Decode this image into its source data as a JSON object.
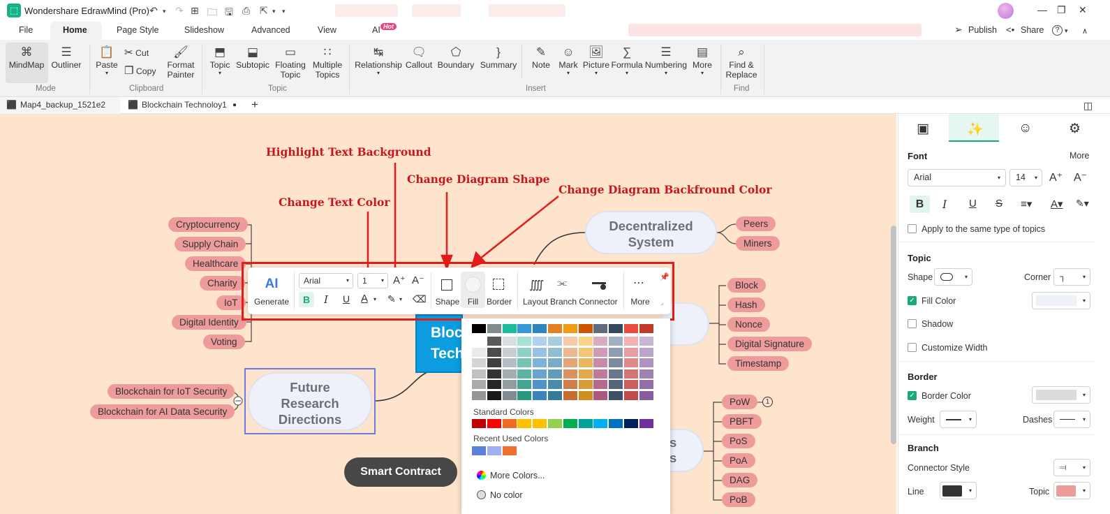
{
  "app": {
    "title": "Wondershare EdrawMind (Pro)",
    "logo_icon": "edrawmind-logo"
  },
  "menu": {
    "items": [
      "File",
      "Home",
      "Page Style",
      "Slideshow",
      "Advanced",
      "View",
      "AI"
    ],
    "active": "Home",
    "ai_badge": "Hot",
    "publish": "Publish",
    "share": "Share",
    "help": "?"
  },
  "ribbon": {
    "mode": {
      "label": "Mode",
      "mindmap": "MindMap",
      "outliner": "Outliner"
    },
    "clipboard": {
      "label": "Clipboard",
      "paste": "Paste",
      "cut": "Cut",
      "copy": "Copy",
      "format_painter": [
        "Format",
        "Painter"
      ]
    },
    "topic": {
      "label": "Topic",
      "topic": "Topic",
      "subtopic": "Subtopic",
      "floating": [
        "Floating",
        "Topic"
      ],
      "multiple": [
        "Multiple",
        "Topics"
      ]
    },
    "insert": {
      "label": "Insert",
      "relationship": "Relationship",
      "callout": "Callout",
      "boundary": "Boundary",
      "summary": "Summary",
      "note": "Note",
      "mark": "Mark",
      "picture": "Picture",
      "formula": "Formula",
      "numbering": "Numbering",
      "more": "More"
    },
    "find": {
      "label": "Find",
      "find_replace": [
        "Find &",
        "Replace"
      ]
    }
  },
  "tabs": [
    {
      "label": "Map4_backup_1521e2"
    },
    {
      "label": "Blockchain Technoloy1",
      "modified": true
    }
  ],
  "annotations": {
    "highlight": "Highlight Text Background",
    "shape": "Change Diagram Shape",
    "backcolor": "Change Diagram Backfround Color",
    "textcolor": "Change Text Color"
  },
  "mindmap": {
    "left_branches": [
      "Cryptocurrency",
      "Supply Chain",
      "Healthcare",
      "Charity",
      "IoT",
      "Digital Identity",
      "Voting"
    ],
    "future_topic": [
      "Future",
      "Research",
      "Directions"
    ],
    "future_subs": [
      "Blockchain for IoT Security",
      "Blockchain for AI Data Security"
    ],
    "decentralized": [
      "Decentralized",
      "System"
    ],
    "decentralized_subs": [
      "Peers",
      "Miners"
    ],
    "block_subs": [
      "Block",
      "Hash",
      "Nonce",
      "Digital Signature",
      "Timestamp"
    ],
    "consensus_subs": [
      "PoW",
      "PBFT",
      "PoS",
      "PoA",
      "DAG",
      "PoB"
    ],
    "consensus_partial": [
      "s",
      "s"
    ],
    "pow_badge": "1",
    "central_partial": [
      "Block",
      "Tech"
    ],
    "smart_contract": "Smart Contract"
  },
  "floating_toolbar": {
    "generate": "Generate",
    "ai_icon_text": "AI",
    "font": "Arial",
    "size": "1",
    "bold": "B",
    "italic": "I",
    "underline": "U",
    "text_color": "A",
    "shape": "Shape",
    "fill": "Fill",
    "border": "Border",
    "layout": "Layout",
    "branch": "Branch",
    "connector": "Connector",
    "more": "More"
  },
  "palette": {
    "top_row": [
      "#000000",
      "#7f8c8d",
      "#1abc9c",
      "#3498db",
      "#2e86c1",
      "#e67e22",
      "#f39c12",
      "#d35400",
      "#5d6d7e",
      "#34495e",
      "#e74c3c",
      "#c0392b"
    ],
    "columns": [
      "#ffffff",
      "#595959",
      "#d8dfe4",
      "#a6e1d6",
      "#b0d2ef",
      "#a8cde1",
      "#f7c9a9",
      "#fbd28a",
      "#d9abc0",
      "#a3b0c2",
      "#f2b2b4",
      "#c7b6d4"
    ],
    "dark_columns": [
      "#808080",
      "#0d0d0d",
      "#6d7a80",
      "#11896f",
      "#2174b5",
      "#1a6a8c",
      "#bd5a19",
      "#c9810a",
      "#a34876",
      "#2c3e55",
      "#b83636",
      "#7a4c8f"
    ],
    "standard_label": "Standard Colors",
    "standard": [
      "#c00000",
      "#ff0000",
      "#f06a25",
      "#ffc000",
      "#ffc000",
      "#92d050",
      "#00b050",
      "#00a39a",
      "#00b0f0",
      "#0070c0",
      "#002060",
      "#7030a0"
    ],
    "recent_label": "Recent Used Colors",
    "recent": [
      "#5b7fdb",
      "#9db1f2",
      "#f07030"
    ],
    "more_colors": "More Colors...",
    "no_color": "No color"
  },
  "panel": {
    "font_label": "Font",
    "more": "More",
    "font_family": "Arial",
    "font_size": "14",
    "apply_same": "Apply to the same type of topics",
    "topic_label": "Topic",
    "shape": "Shape",
    "corner": "Corner",
    "fill_color": "Fill Color",
    "shadow": "Shadow",
    "customize_width": "Customize Width",
    "border_label": "Border",
    "border_color": "Border Color",
    "weight": "Weight",
    "dashes": "Dashes",
    "branch_label": "Branch",
    "connector_style": "Connector Style",
    "line": "Line",
    "topic": "Topic",
    "fill_swatch": "#eef1fa",
    "border_swatch": "#dcdcdc",
    "line_swatch": "#333333",
    "topic_swatch": "#ee9c9b"
  }
}
